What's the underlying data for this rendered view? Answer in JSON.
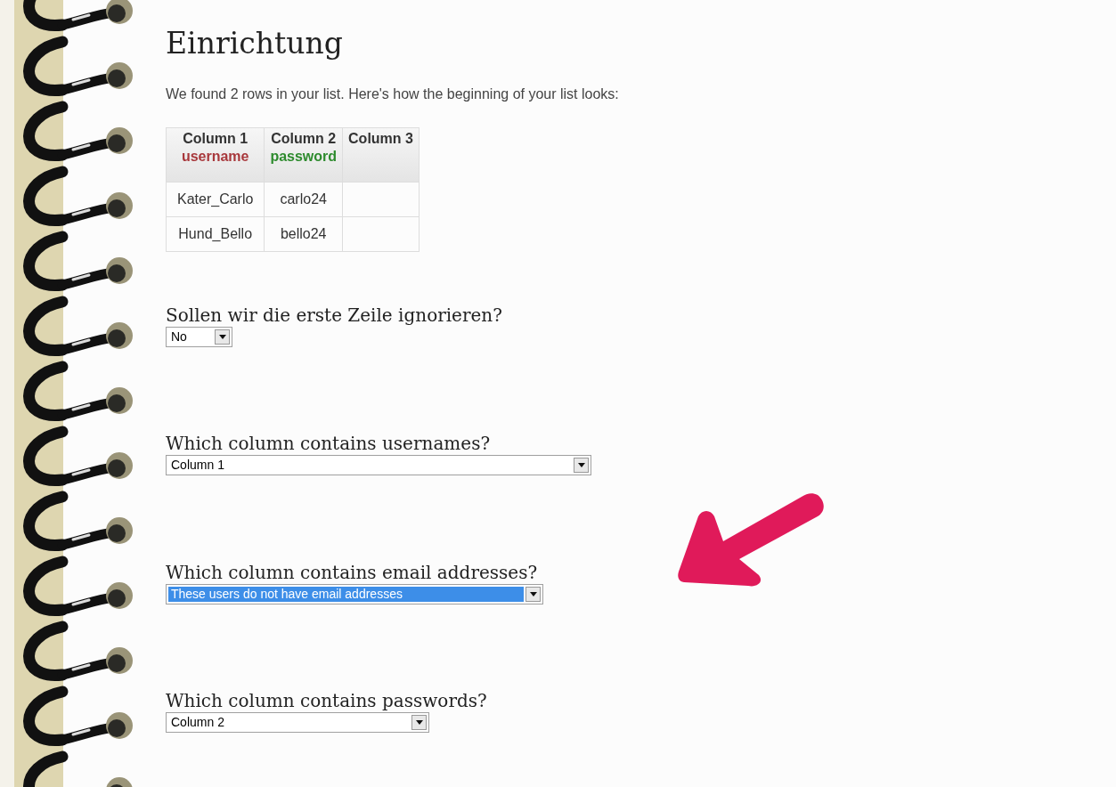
{
  "title": "Einrichtung",
  "intro": "We found 2 rows in your list. Here's how the beginning of your list looks:",
  "preview_table": {
    "columns": [
      {
        "label": "Column 1",
        "role": "username",
        "color": "#a8383c"
      },
      {
        "label": "Column 2",
        "role": "password",
        "color": "#2e8b2e"
      },
      {
        "label": "Column 3"
      }
    ],
    "rows": [
      [
        "Kater_Carlo",
        "carlo24",
        ""
      ],
      [
        "Hund_Bello",
        "bello24",
        ""
      ]
    ]
  },
  "questions": [
    {
      "label": "Sollen wir die erste Zeile ignorieren?",
      "value": "No",
      "focused": false
    },
    {
      "label": "Which column contains usernames?",
      "value": "Column 1",
      "focused": false
    },
    {
      "label": "Which column contains email addresses?",
      "value": "These users do not have email addresses",
      "focused": true
    },
    {
      "label": "Which column contains passwords?",
      "value": "Column 2",
      "focused": false
    }
  ]
}
